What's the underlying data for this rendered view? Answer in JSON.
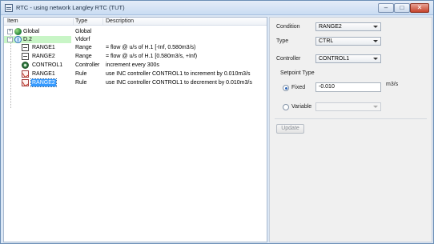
{
  "window": {
    "title": "RTC - using network Langley RTC (TUT)",
    "controls": {
      "minimize": "–",
      "maximize": "□",
      "close": "✕"
    }
  },
  "tree": {
    "columns": [
      "Item",
      "Type",
      "Description"
    ],
    "rows": [
      {
        "item": "Global",
        "type": "Global",
        "description": "",
        "expander": "+"
      },
      {
        "item": "D.2",
        "type": "Vldorf",
        "description": "",
        "expander": "−"
      },
      {
        "item": "RANGE1",
        "type": "Range",
        "description": "= flow @ u/s of H.1 [-Inf, 0.580m3/s)"
      },
      {
        "item": "RANGE2",
        "type": "Range",
        "description": "= flow @ u/s of H.1 [0.580m3/s, +Inf)"
      },
      {
        "item": "CONTROL1",
        "type": "Controller",
        "description": "increment every 300s"
      },
      {
        "item": "RANGE1",
        "type": "Rule",
        "description": "use INC controller CONTROL1 to increment by 0.010m3/s"
      },
      {
        "item": "RANGE2",
        "type": "Rule",
        "description": "use INC controller CONTROL1 to decrement by 0.010m3/s"
      }
    ]
  },
  "panel": {
    "condition_label": "Condition",
    "condition_value": "RANGE2",
    "type_label": "Type",
    "type_value": "CTRL",
    "controller_label": "Controller",
    "controller_value": "CONTROL1",
    "setpoint_type_label": "Setpoint Type",
    "fixed_label": "Fixed",
    "fixed_value": "-0.010",
    "fixed_unit": "m3/s",
    "variable_label": "Variable",
    "variable_value": "",
    "update_label": "Update"
  },
  "colors": {
    "selected_row": "#c8f5c6",
    "highlight": "#3399ff",
    "close_button": "#c6432c"
  }
}
